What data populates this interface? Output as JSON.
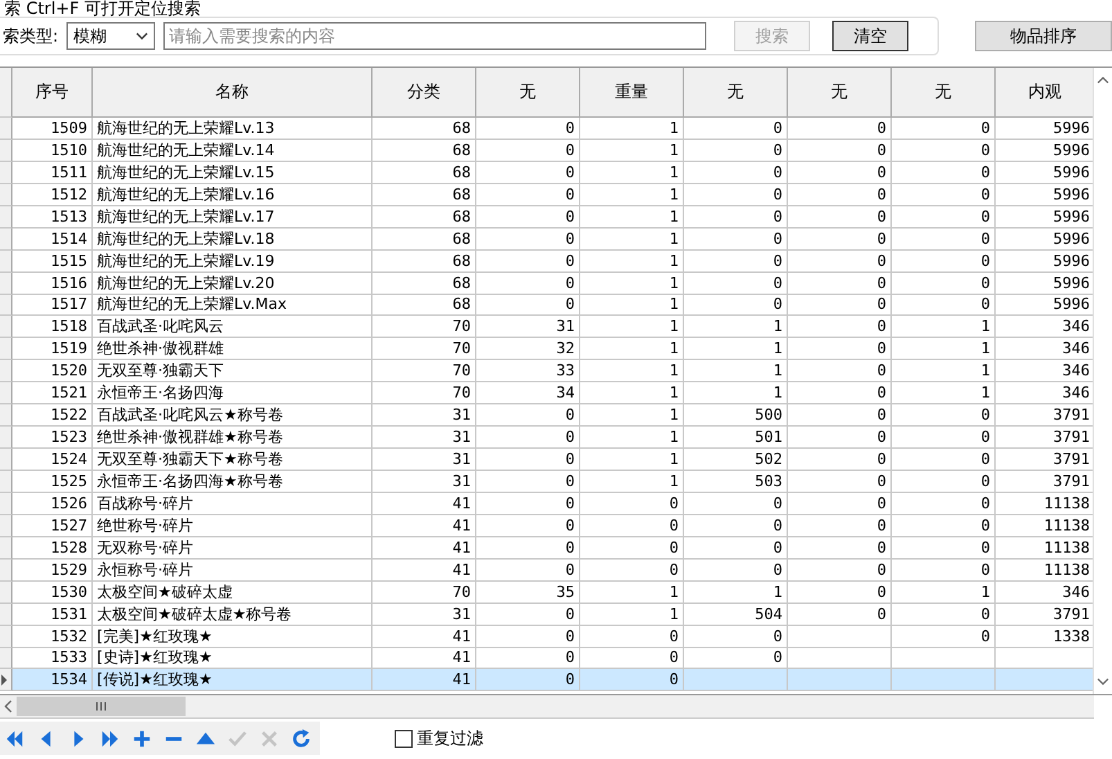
{
  "hint": "索  Ctrl+F 可打开定位搜索",
  "search": {
    "type_label": "索类型:",
    "mode": "模糊",
    "placeholder": "请输入需要搜索的内容",
    "buttons": [
      {
        "label": "搜索",
        "disabled": true
      },
      {
        "label": "清空",
        "disabled": false
      }
    ],
    "sort_button": "物品排序"
  },
  "table": {
    "columns": [
      "序号",
      "名称",
      "分类",
      "无",
      "重量",
      "无",
      "无",
      "无",
      "内观"
    ],
    "rows": [
      {
        "selected": false,
        "cells": [
          "1509",
          "航海世纪的无上荣耀Lv.13",
          "68",
          "0",
          "1",
          "0",
          "0",
          "0",
          "5996"
        ]
      },
      {
        "selected": false,
        "cells": [
          "1510",
          "航海世纪的无上荣耀Lv.14",
          "68",
          "0",
          "1",
          "0",
          "0",
          "0",
          "5996"
        ]
      },
      {
        "selected": false,
        "cells": [
          "1511",
          "航海世纪的无上荣耀Lv.15",
          "68",
          "0",
          "1",
          "0",
          "0",
          "0",
          "5996"
        ]
      },
      {
        "selected": false,
        "cells": [
          "1512",
          "航海世纪的无上荣耀Lv.16",
          "68",
          "0",
          "1",
          "0",
          "0",
          "0",
          "5996"
        ]
      },
      {
        "selected": false,
        "cells": [
          "1513",
          "航海世纪的无上荣耀Lv.17",
          "68",
          "0",
          "1",
          "0",
          "0",
          "0",
          "5996"
        ]
      },
      {
        "selected": false,
        "cells": [
          "1514",
          "航海世纪的无上荣耀Lv.18",
          "68",
          "0",
          "1",
          "0",
          "0",
          "0",
          "5996"
        ]
      },
      {
        "selected": false,
        "cells": [
          "1515",
          "航海世纪的无上荣耀Lv.19",
          "68",
          "0",
          "1",
          "0",
          "0",
          "0",
          "5996"
        ]
      },
      {
        "selected": false,
        "cells": [
          "1516",
          "航海世纪的无上荣耀Lv.20",
          "68",
          "0",
          "1",
          "0",
          "0",
          "0",
          "5996"
        ]
      },
      {
        "selected": false,
        "cells": [
          "1517",
          "航海世纪的无上荣耀Lv.Max",
          "68",
          "0",
          "1",
          "0",
          "0",
          "0",
          "5996"
        ]
      },
      {
        "selected": false,
        "cells": [
          "1518",
          "百战武圣·叱咤风云",
          "70",
          "31",
          "1",
          "1",
          "0",
          "1",
          "346"
        ]
      },
      {
        "selected": false,
        "cells": [
          "1519",
          "绝世杀神·傲视群雄",
          "70",
          "32",
          "1",
          "1",
          "0",
          "1",
          "346"
        ]
      },
      {
        "selected": false,
        "cells": [
          "1520",
          "无双至尊·独霸天下",
          "70",
          "33",
          "1",
          "1",
          "0",
          "1",
          "346"
        ]
      },
      {
        "selected": false,
        "cells": [
          "1521",
          "永恒帝王·名扬四海",
          "70",
          "34",
          "1",
          "1",
          "0",
          "1",
          "346"
        ]
      },
      {
        "selected": false,
        "cells": [
          "1522",
          "百战武圣·叱咤风云★称号卷",
          "31",
          "0",
          "1",
          "500",
          "0",
          "0",
          "3791"
        ]
      },
      {
        "selected": false,
        "cells": [
          "1523",
          "绝世杀神·傲视群雄★称号卷",
          "31",
          "0",
          "1",
          "501",
          "0",
          "0",
          "3791"
        ]
      },
      {
        "selected": false,
        "cells": [
          "1524",
          "无双至尊·独霸天下★称号卷",
          "31",
          "0",
          "1",
          "502",
          "0",
          "0",
          "3791"
        ]
      },
      {
        "selected": false,
        "cells": [
          "1525",
          "永恒帝王·名扬四海★称号卷",
          "31",
          "0",
          "1",
          "503",
          "0",
          "0",
          "3791"
        ]
      },
      {
        "selected": false,
        "cells": [
          "1526",
          "百战称号·碎片",
          "41",
          "0",
          "0",
          "0",
          "0",
          "0",
          "11138"
        ]
      },
      {
        "selected": false,
        "cells": [
          "1527",
          "绝世称号·碎片",
          "41",
          "0",
          "0",
          "0",
          "0",
          "0",
          "11138"
        ]
      },
      {
        "selected": false,
        "cells": [
          "1528",
          "无双称号·碎片",
          "41",
          "0",
          "0",
          "0",
          "0",
          "0",
          "11138"
        ]
      },
      {
        "selected": false,
        "cells": [
          "1529",
          "永恒称号·碎片",
          "41",
          "0",
          "0",
          "0",
          "0",
          "0",
          "11138"
        ]
      },
      {
        "selected": false,
        "cells": [
          "1530",
          "太极空间★破碎太虚",
          "70",
          "35",
          "1",
          "1",
          "0",
          "1",
          "346"
        ]
      },
      {
        "selected": false,
        "cells": [
          "1531",
          "太极空间★破碎太虚★称号卷",
          "31",
          "0",
          "1",
          "504",
          "0",
          "0",
          "3791"
        ]
      },
      {
        "selected": false,
        "cells": [
          "1532",
          "[完美]★红玫瑰★",
          "41",
          "0",
          "0",
          "0",
          null,
          "0",
          "1338"
        ]
      },
      {
        "selected": false,
        "cells": [
          "1533",
          "[史诗]★红玫瑰★",
          "41",
          "0",
          "0",
          "0",
          null,
          null,
          null
        ]
      },
      {
        "selected": true,
        "cells": [
          "1534",
          "[传说]★红玫瑰★",
          "41",
          "0",
          "0",
          null,
          null,
          null,
          null
        ]
      }
    ]
  },
  "toolbar": [
    {
      "kind": "first",
      "disabled": false
    },
    {
      "kind": "prev",
      "disabled": false
    },
    {
      "kind": "next",
      "disabled": false
    },
    {
      "kind": "last",
      "disabled": false
    },
    {
      "kind": "add",
      "disabled": false
    },
    {
      "kind": "remove",
      "disabled": false
    },
    {
      "kind": "up",
      "disabled": false
    },
    {
      "kind": "confirm",
      "disabled": true
    },
    {
      "kind": "cancel",
      "disabled": true
    },
    {
      "kind": "refresh",
      "disabled": false
    }
  ],
  "dedupe_filter": {
    "label": "重复过滤",
    "checked": false
  }
}
